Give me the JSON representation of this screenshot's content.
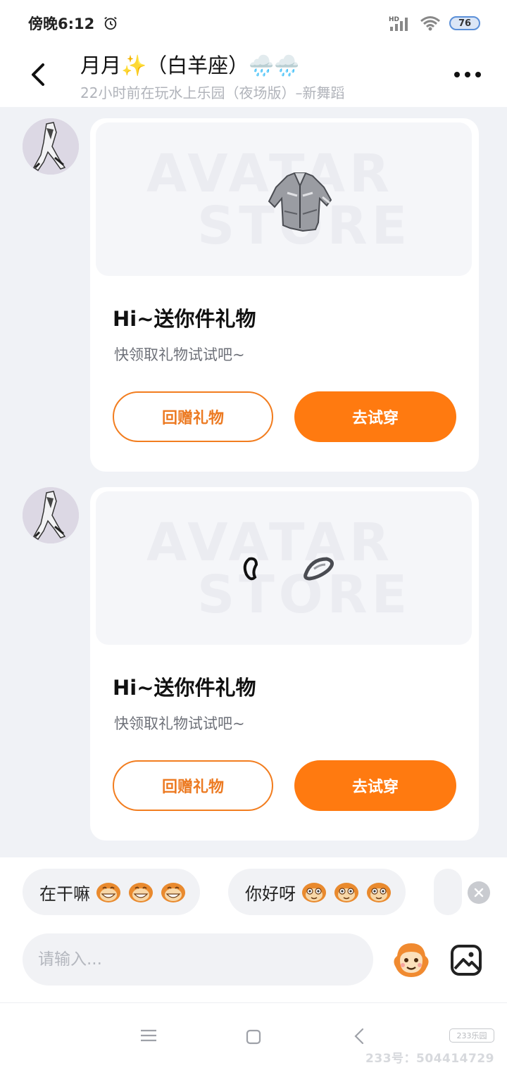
{
  "status_bar": {
    "time": "傍晚6:12",
    "network_label": "HD",
    "battery": "76"
  },
  "header": {
    "title": "月月✨（白羊座）🌧️🌧️",
    "subtitle": "22小时前在玩水上乐园（夜场版）–新舞蹈"
  },
  "messages": [
    {
      "preview_watermark_top": "AVATAR",
      "preview_watermark_bottom": "STORE",
      "gift_item": "jacket",
      "title": "Hi~送你件礼物",
      "description": "快领取礼物试试吧~",
      "return_label": "回赠礼物",
      "try_label": "去试穿"
    },
    {
      "preview_watermark_top": "AVATAR",
      "preview_watermark_bottom": "STORE",
      "gift_item": "earrings",
      "title": "Hi~送你件礼物",
      "description": "快领取礼物试试吧~",
      "return_label": "回赠礼物",
      "try_label": "去试穿"
    }
  ],
  "quick_replies": [
    {
      "text": "在干嘛",
      "emoji": "grin-monkey-face"
    },
    {
      "text": "你好呀",
      "emoji": "smile-monkey-face"
    }
  ],
  "input": {
    "placeholder": "请输入..."
  },
  "footer": {
    "site_badge": "233乐园",
    "site_id": "233号：504414729"
  },
  "colors": {
    "accent": "#ff7a10",
    "background": "#f0f2f6",
    "card": "#ffffff"
  }
}
